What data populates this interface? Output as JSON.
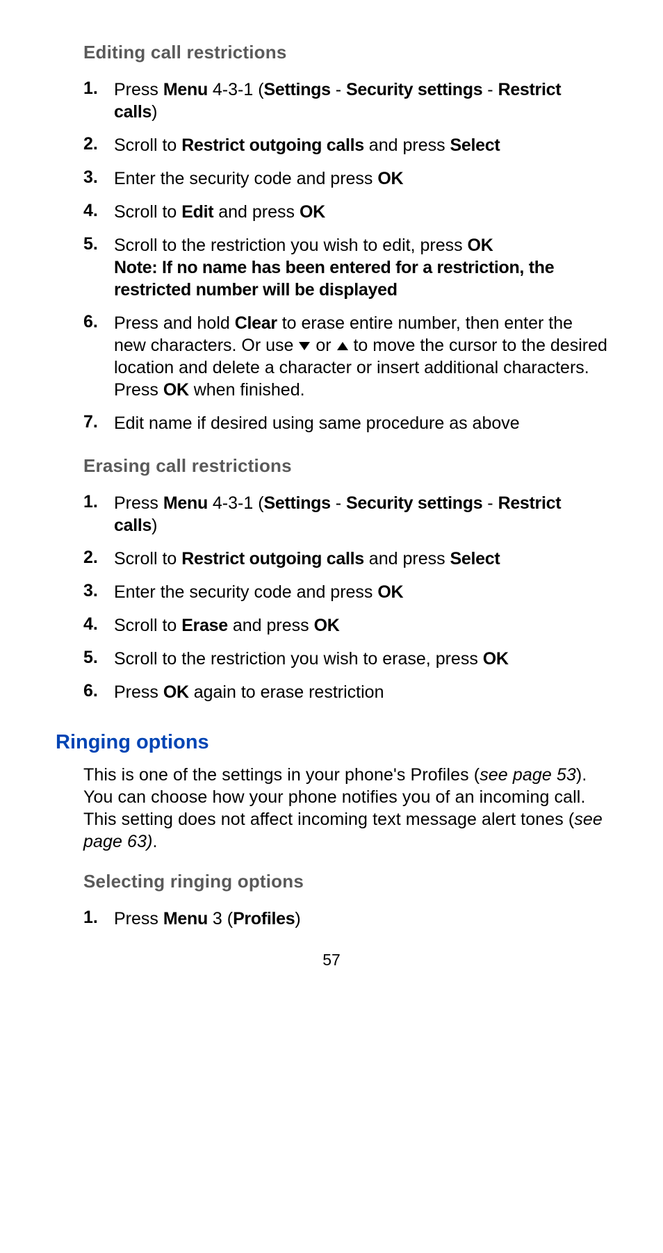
{
  "sections": {
    "s1": {
      "heading": "Editing call restrictions",
      "items": {
        "n1_a": "Press ",
        "n1_menu": "Menu",
        "n1_b": " 4-3-1 (",
        "n1_set": "Settings",
        "n1_dash1": " - ",
        "n1_sec": "Security settings",
        "n1_dash2": " - ",
        "n1_rc": "Restrict calls",
        "n1_c": ")",
        "n2_a": "Scroll to ",
        "n2_roc": "Restrict outgoing calls",
        "n2_b": " and press ",
        "n2_sel": "Select",
        "n3_a": "Enter the security code and press ",
        "n3_ok": "OK",
        "n4_a": "Scroll to ",
        "n4_edit": "Edit",
        "n4_b": " and press ",
        "n4_ok": "OK",
        "n5_a": "Scroll to the restriction you wish to edit, press ",
        "n5_ok": "OK",
        "n5_note": "Note: If no name has been entered for a restriction, the restricted number will be displayed",
        "n6_a": "Press and hold ",
        "n6_clear": "Clear",
        "n6_b": " to erase entire number, then enter the new characters. Or use ",
        "n6_c": " or ",
        "n6_d": " to move the cursor to the desired location and delete a character or insert additional characters. Press ",
        "n6_ok": "OK",
        "n6_e": " when finished.",
        "n7_a": "Edit name if desired using same procedure as above"
      }
    },
    "s2": {
      "heading": "Erasing call restrictions",
      "items": {
        "n1_a": "Press ",
        "n1_menu": "Menu",
        "n1_b": " 4-3-1 (",
        "n1_set": "Settings",
        "n1_dash1": " - ",
        "n1_sec": "Security settings",
        "n1_dash2": " - ",
        "n1_rc": "Restrict calls",
        "n1_c": ")",
        "n2_a": "Scroll to ",
        "n2_roc": "Restrict outgoing calls",
        "n2_b": " and press ",
        "n2_sel": "Select",
        "n3_a": "Enter the security code and press ",
        "n3_ok": "OK",
        "n4_a": "Scroll to ",
        "n4_erase": "Erase",
        "n4_b": " and press ",
        "n4_ok": "OK",
        "n5_a": "Scroll to the restriction you wish to erase, press ",
        "n5_ok": "OK",
        "n6_a": "Press ",
        "n6_ok": "OK",
        "n6_b": " again to erase restriction"
      }
    },
    "ringing": {
      "heading": "Ringing options",
      "intro_a": "This is one of the settings in your phone's Profiles (",
      "intro_see1": "see page 53",
      "intro_b": "). You can choose how your phone notifies you of an incoming call. This setting does not affect incoming text message alert tones (",
      "intro_see2": "see page 63)",
      "intro_c": "."
    },
    "s3": {
      "heading": "Selecting ringing options",
      "items": {
        "n1_a": "Press ",
        "n1_menu": "Menu",
        "n1_b": " 3 (",
        "n1_prof": "Profiles",
        "n1_c": ")"
      }
    }
  },
  "nums": {
    "n1": "1.",
    "n2": "2.",
    "n3": "3.",
    "n4": "4.",
    "n5": "5.",
    "n6": "6.",
    "n7": "7."
  },
  "page_number": "57"
}
